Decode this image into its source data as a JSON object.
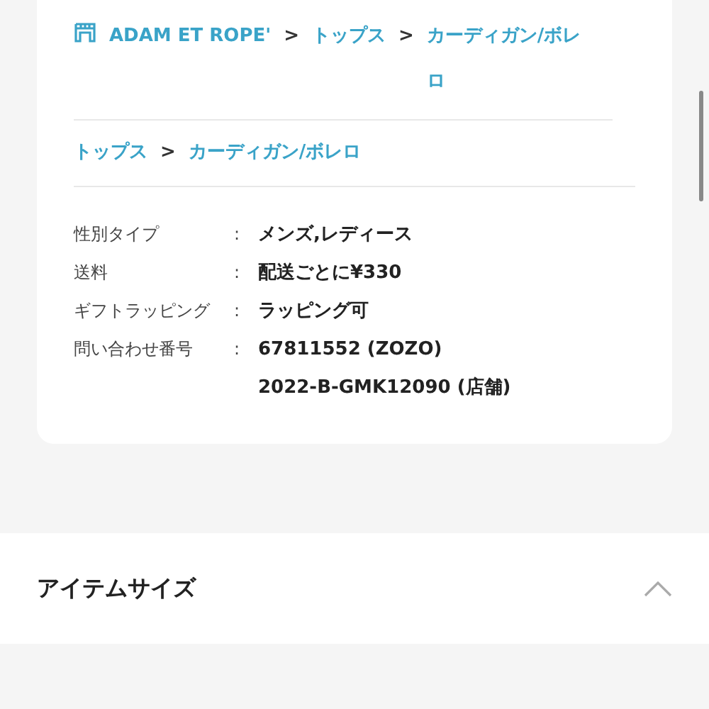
{
  "breadcrumbs": [
    {
      "separator": ">",
      "items": [
        {
          "label": "ADAM ET ROPE'",
          "kind": "shop"
        },
        {
          "label": "トップス",
          "kind": "link"
        },
        {
          "label": "カーディガン/ボレロ",
          "kind": "link"
        }
      ]
    },
    {
      "separator": ">",
      "items": [
        {
          "label": "トップス",
          "kind": "link"
        },
        {
          "label": "カーディガン/ボレロ",
          "kind": "link"
        }
      ]
    }
  ],
  "specs": [
    {
      "label": "性別タイプ",
      "colon": ":",
      "values": [
        "メンズ,レディース"
      ]
    },
    {
      "label": "送料",
      "colon": ":",
      "values": [
        "配送ごとに¥330"
      ]
    },
    {
      "label": "ギフトラッピング",
      "colon": ":",
      "values": [
        "ラッピング可"
      ]
    },
    {
      "label": "問い合わせ番号",
      "colon": ":",
      "values": [
        "67811552 (ZOZO)",
        "2022-B-GMK12090 (店舗)"
      ]
    }
  ],
  "section": {
    "title": "アイテムサイズ",
    "expanded": true
  }
}
